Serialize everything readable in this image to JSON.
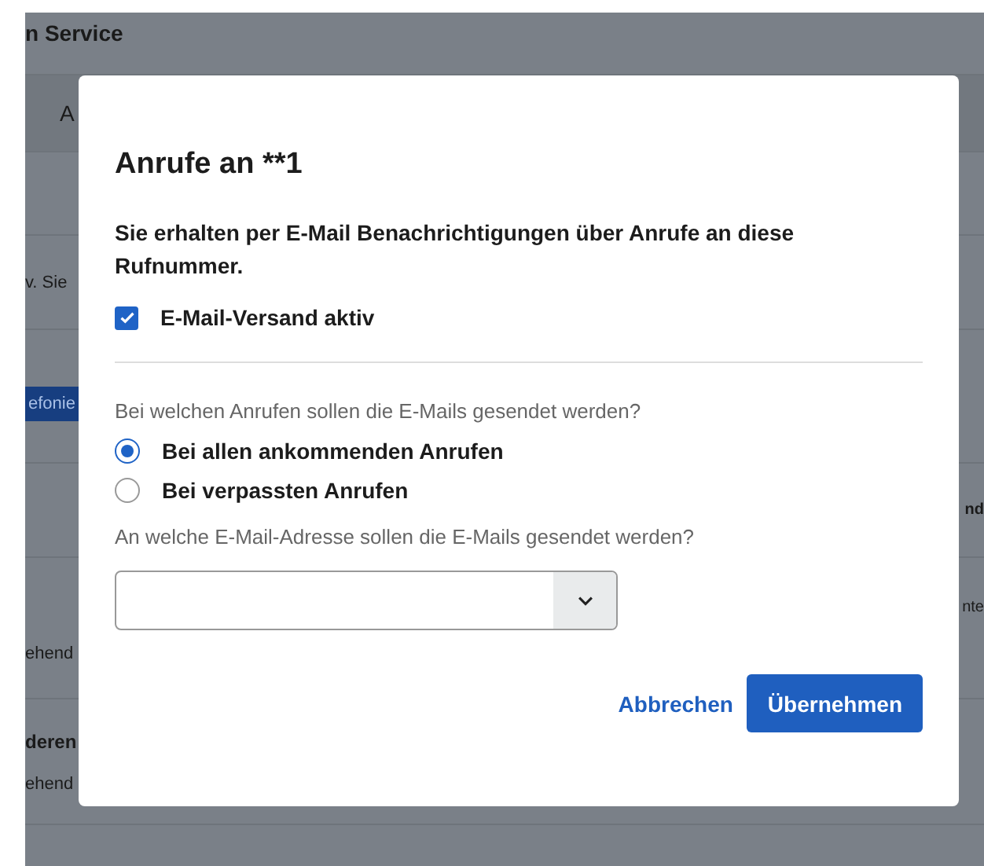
{
  "background": {
    "title": "n Service",
    "tab": "A",
    "note": "v. Sie",
    "button": "efonie",
    "rows": [
      {
        "right": "nd"
      },
      {
        "left_sub": "ehend",
        "right": "nte"
      },
      {
        "left": "deren",
        "left_sub": "ehend"
      }
    ]
  },
  "dialog": {
    "title": "Anrufe an **1",
    "description": "Sie erhalten per E-Mail Benachrichtigungen über Anrufe an diese Rufnummer.",
    "email_active": {
      "label": "E-Mail-Versand aktiv",
      "checked": true
    },
    "calls_question": "Bei welchen Anrufen sollen die E-Mails gesendet werden?",
    "call_options": [
      {
        "label": "Bei allen ankommenden Anrufen",
        "selected": true
      },
      {
        "label": "Bei verpassten Anrufen",
        "selected": false
      }
    ],
    "address_question": "An welche E-Mail-Adresse sollen die E-Mails gesendet werden?",
    "buttons": {
      "cancel": "Abbrechen",
      "apply": "Übernehmen"
    }
  }
}
